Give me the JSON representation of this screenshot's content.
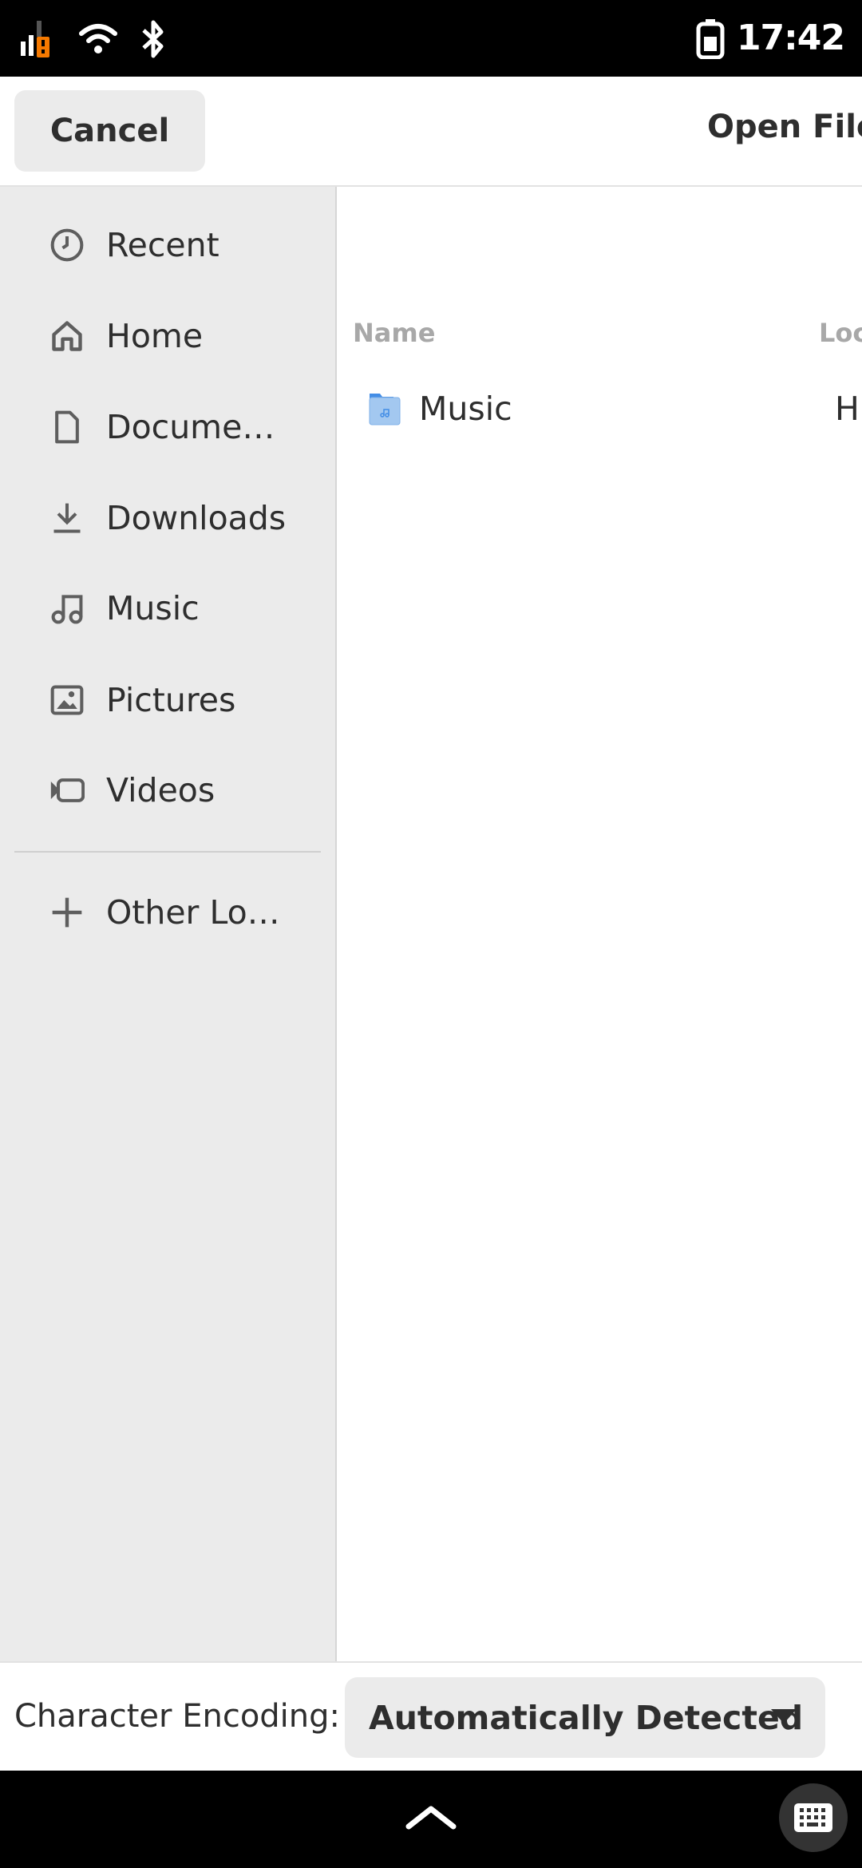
{
  "status_bar": {
    "time": "17:42",
    "icons": [
      "signal-icon",
      "wifi-icon",
      "bluetooth-icon",
      "battery-icon"
    ],
    "warning_color": "#f57900"
  },
  "header": {
    "cancel_label": "Cancel",
    "title": "Open File"
  },
  "sidebar": {
    "items": [
      {
        "label": "Recent",
        "icon": "clock-icon"
      },
      {
        "label": "Home",
        "icon": "home-icon"
      },
      {
        "label": "Docume…",
        "icon": "document-icon"
      },
      {
        "label": "Downloads",
        "icon": "download-icon"
      },
      {
        "label": "Music",
        "icon": "music-icon"
      },
      {
        "label": "Pictures",
        "icon": "image-icon"
      },
      {
        "label": "Videos",
        "icon": "video-icon"
      },
      {
        "label": "Other Lo…",
        "icon": "plus-icon"
      }
    ]
  },
  "file_list": {
    "columns": [
      "Name",
      "Loc"
    ],
    "rows": [
      {
        "name": "Music",
        "location": "H",
        "icon": "music-folder-icon"
      }
    ]
  },
  "footer": {
    "encoding_label": "Character Encoding:",
    "encoding_value": "Automatically Detected"
  },
  "colors": {
    "folder": "#a3c8f0",
    "folder_tab": "#438de6"
  }
}
